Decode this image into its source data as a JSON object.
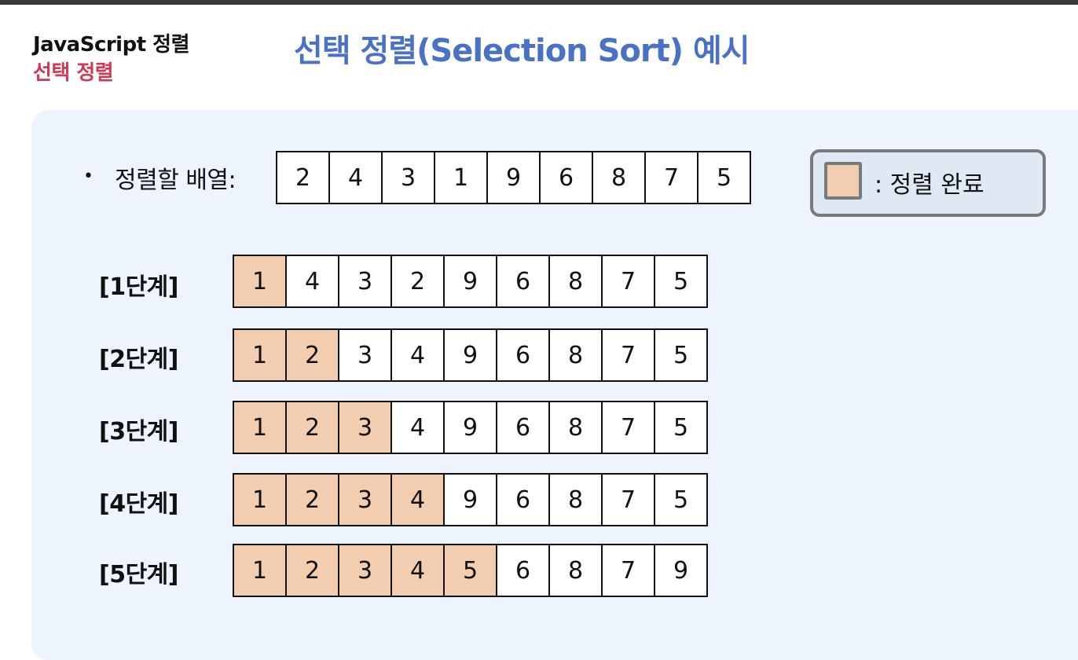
{
  "header": {
    "course_title": "JavaScript 정렬",
    "topic_title": "선택 정렬",
    "slide_title": "선택 정렬(Selection Sort) 예시"
  },
  "input_array": {
    "bullet": "•",
    "label": "정렬할 배열:",
    "values": [
      "2",
      "4",
      "3",
      "1",
      "9",
      "6",
      "8",
      "7",
      "5"
    ]
  },
  "legend": {
    "label": ": 정렬 완료",
    "swatch_color": "#f2cdb0"
  },
  "steps": [
    {
      "label": "[1단계]",
      "values": [
        "1",
        "4",
        "3",
        "2",
        "9",
        "6",
        "8",
        "7",
        "5"
      ],
      "sorted_count": 1
    },
    {
      "label": "[2단계]",
      "values": [
        "1",
        "2",
        "3",
        "4",
        "9",
        "6",
        "8",
        "7",
        "5"
      ],
      "sorted_count": 2
    },
    {
      "label": "[3단계]",
      "values": [
        "1",
        "2",
        "3",
        "4",
        "9",
        "6",
        "8",
        "7",
        "5"
      ],
      "sorted_count": 3
    },
    {
      "label": "[4단계]",
      "values": [
        "1",
        "2",
        "3",
        "4",
        "9",
        "6",
        "8",
        "7",
        "5"
      ],
      "sorted_count": 4
    },
    {
      "label": "[5단계]",
      "values": [
        "1",
        "2",
        "3",
        "4",
        "5",
        "6",
        "8",
        "7",
        "9"
      ],
      "sorted_count": 5
    }
  ],
  "colors": {
    "title": "#4a72c4",
    "topic": "#d03a55",
    "panel": "#eef4fe",
    "sorted": "#f2cdb0"
  }
}
